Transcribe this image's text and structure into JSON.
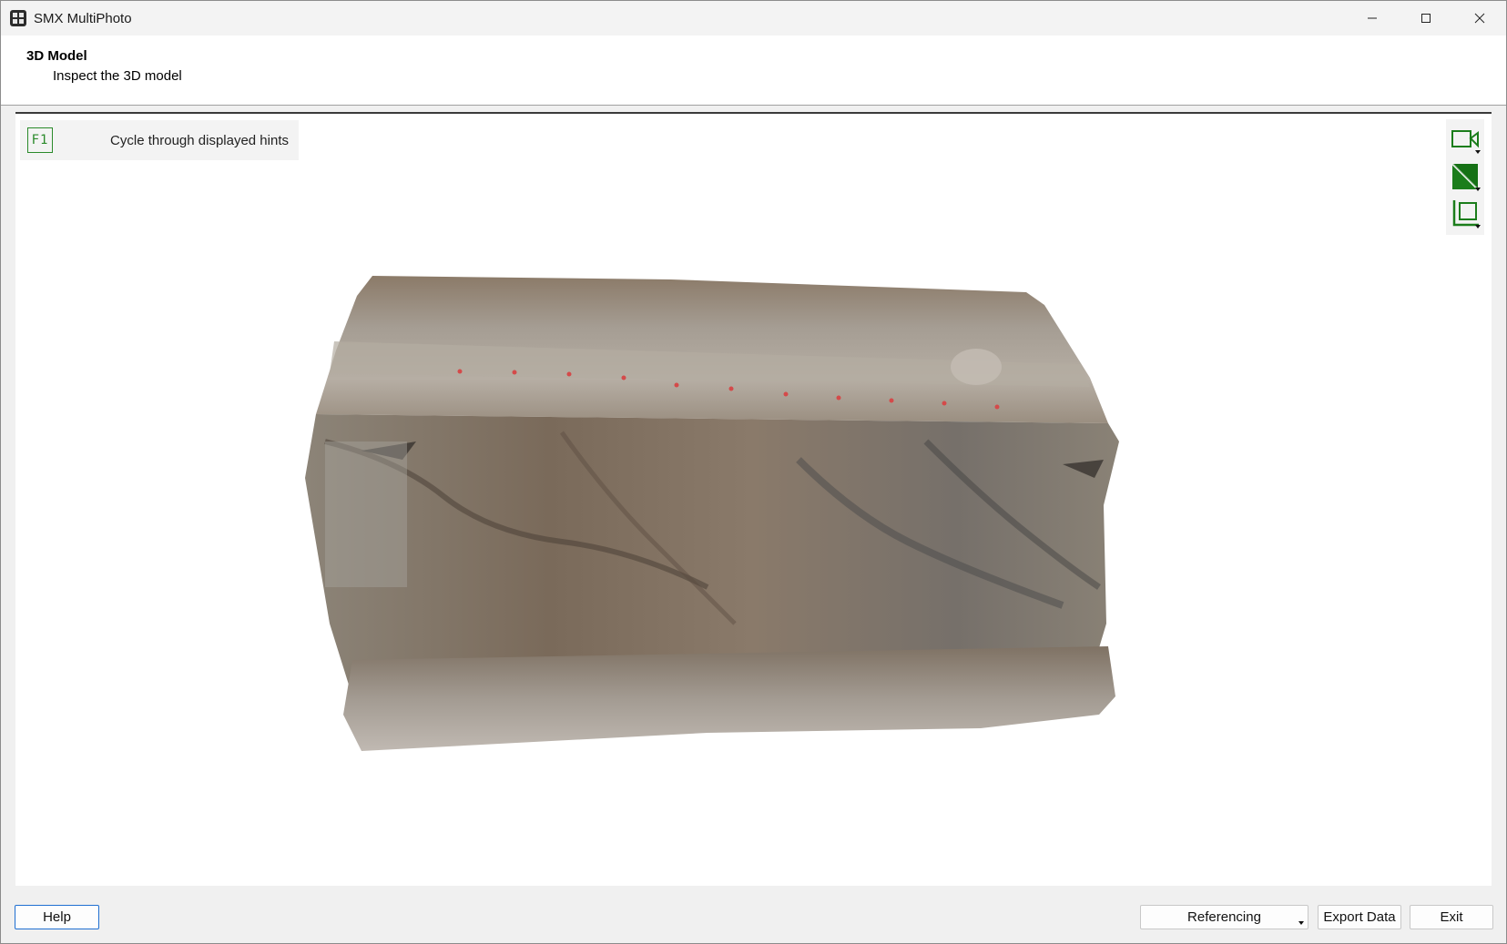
{
  "window": {
    "title": "SMX MultiPhoto",
    "controls": [
      "minimize-icon",
      "maximize-icon",
      "close-icon"
    ]
  },
  "header": {
    "title": "3D Model",
    "subtitle": "Inspect the 3D model"
  },
  "viewport": {
    "hint": {
      "key": "F1",
      "text": "Cycle through displayed hints"
    },
    "tools": [
      {
        "name": "camera-view-icon"
      },
      {
        "name": "texture-mode-icon"
      },
      {
        "name": "crop-icon"
      }
    ],
    "accent_color": "#1b7d1b"
  },
  "footer": {
    "help_label": "Help",
    "referencing_label": "Referencing",
    "export_label": "Export Data",
    "exit_label": "Exit"
  }
}
